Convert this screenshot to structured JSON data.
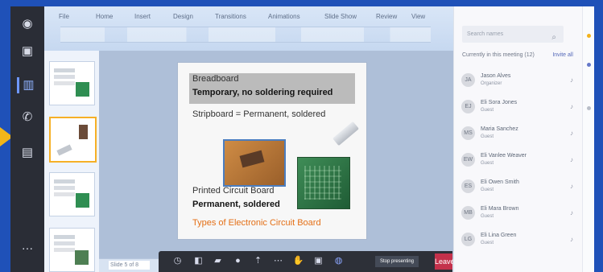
{
  "ribbon": {
    "items": [
      "File",
      "Home",
      "Insert",
      "Design",
      "Transitions",
      "Animations",
      "Slide Show",
      "Review",
      "View"
    ]
  },
  "slide": {
    "line1": "Breadboard",
    "line2": "Temporary, no soldering required",
    "line3": "Stripboard = Permanent, soldered",
    "line4": "Printed Circuit Board",
    "line5": "Permanent, soldered",
    "line6": "Types of Electronic Circuit Board"
  },
  "status": {
    "slide_number": "Slide 5 of 8"
  },
  "meeting": {
    "share_label": "Stop presenting",
    "leave_label": "Leave"
  },
  "chat": {
    "search_placeholder": "Search names",
    "section_label": "Currently in this meeting (12)",
    "section_action": "Invite all",
    "participants": [
      {
        "name": "Jason Alves",
        "status": "Organizer",
        "initials": "JA"
      },
      {
        "name": "Eli Sora Jones",
        "status": "Guest",
        "initials": "EJ"
      },
      {
        "name": "Maria Sanchez",
        "status": "Guest",
        "initials": "MS"
      },
      {
        "name": "Eli Vanlee Weaver",
        "status": "Guest",
        "initials": "EW"
      },
      {
        "name": "Eli Owen Smith",
        "status": "Guest",
        "initials": "ES"
      },
      {
        "name": "Eli Mara Brown",
        "status": "Guest",
        "initials": "MB"
      },
      {
        "name": "Eli Lina Green",
        "status": "Guest",
        "initials": "LG"
      }
    ]
  },
  "icons": {
    "activity": "bell-icon",
    "chat": "chat-icon",
    "teams": "teams-icon",
    "calls": "phone-icon",
    "files": "file-icon",
    "more": "more-icon"
  },
  "colors": {
    "frame_blue": "#1f51b8",
    "highlight_orange": "#f2b61a",
    "leave_red": "#c4314b",
    "active_blue": "#8fb2ff"
  }
}
